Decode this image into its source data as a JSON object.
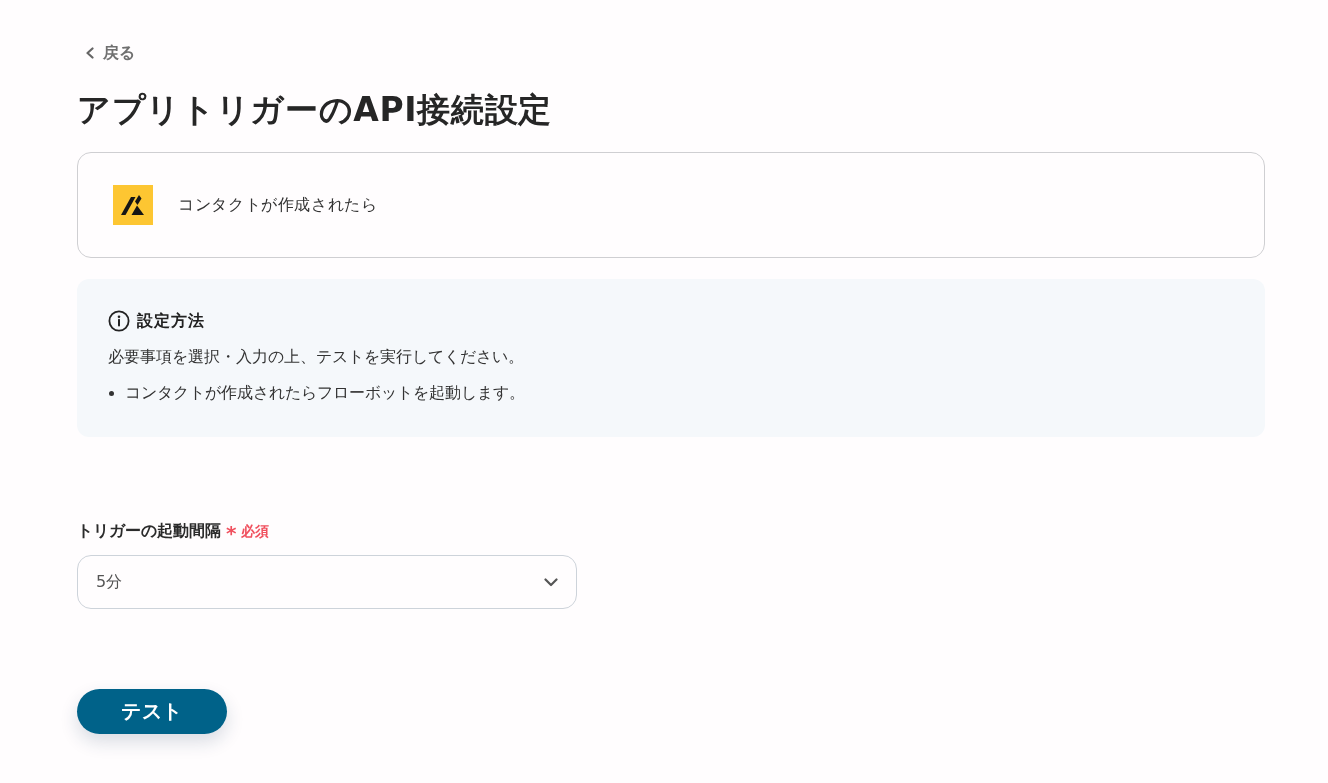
{
  "back_link": {
    "label": "戻る"
  },
  "title": "アプリトリガーのAPI接続設定",
  "trigger_card": {
    "label": "コンタクトが作成されたら"
  },
  "info_box": {
    "heading": "設定方法",
    "text": "必要事項を選択・入力の上、テストを実行してください。",
    "bullets": [
      "コンタクトが作成されたらフローボットを起動します。"
    ]
  },
  "fields": [
    {
      "label": "トリガーの起動間隔",
      "required": true,
      "required_mark": "*",
      "required_label": "必須",
      "value": "5分"
    }
  ],
  "buttons": [
    {
      "label": "テスト"
    }
  ]
}
